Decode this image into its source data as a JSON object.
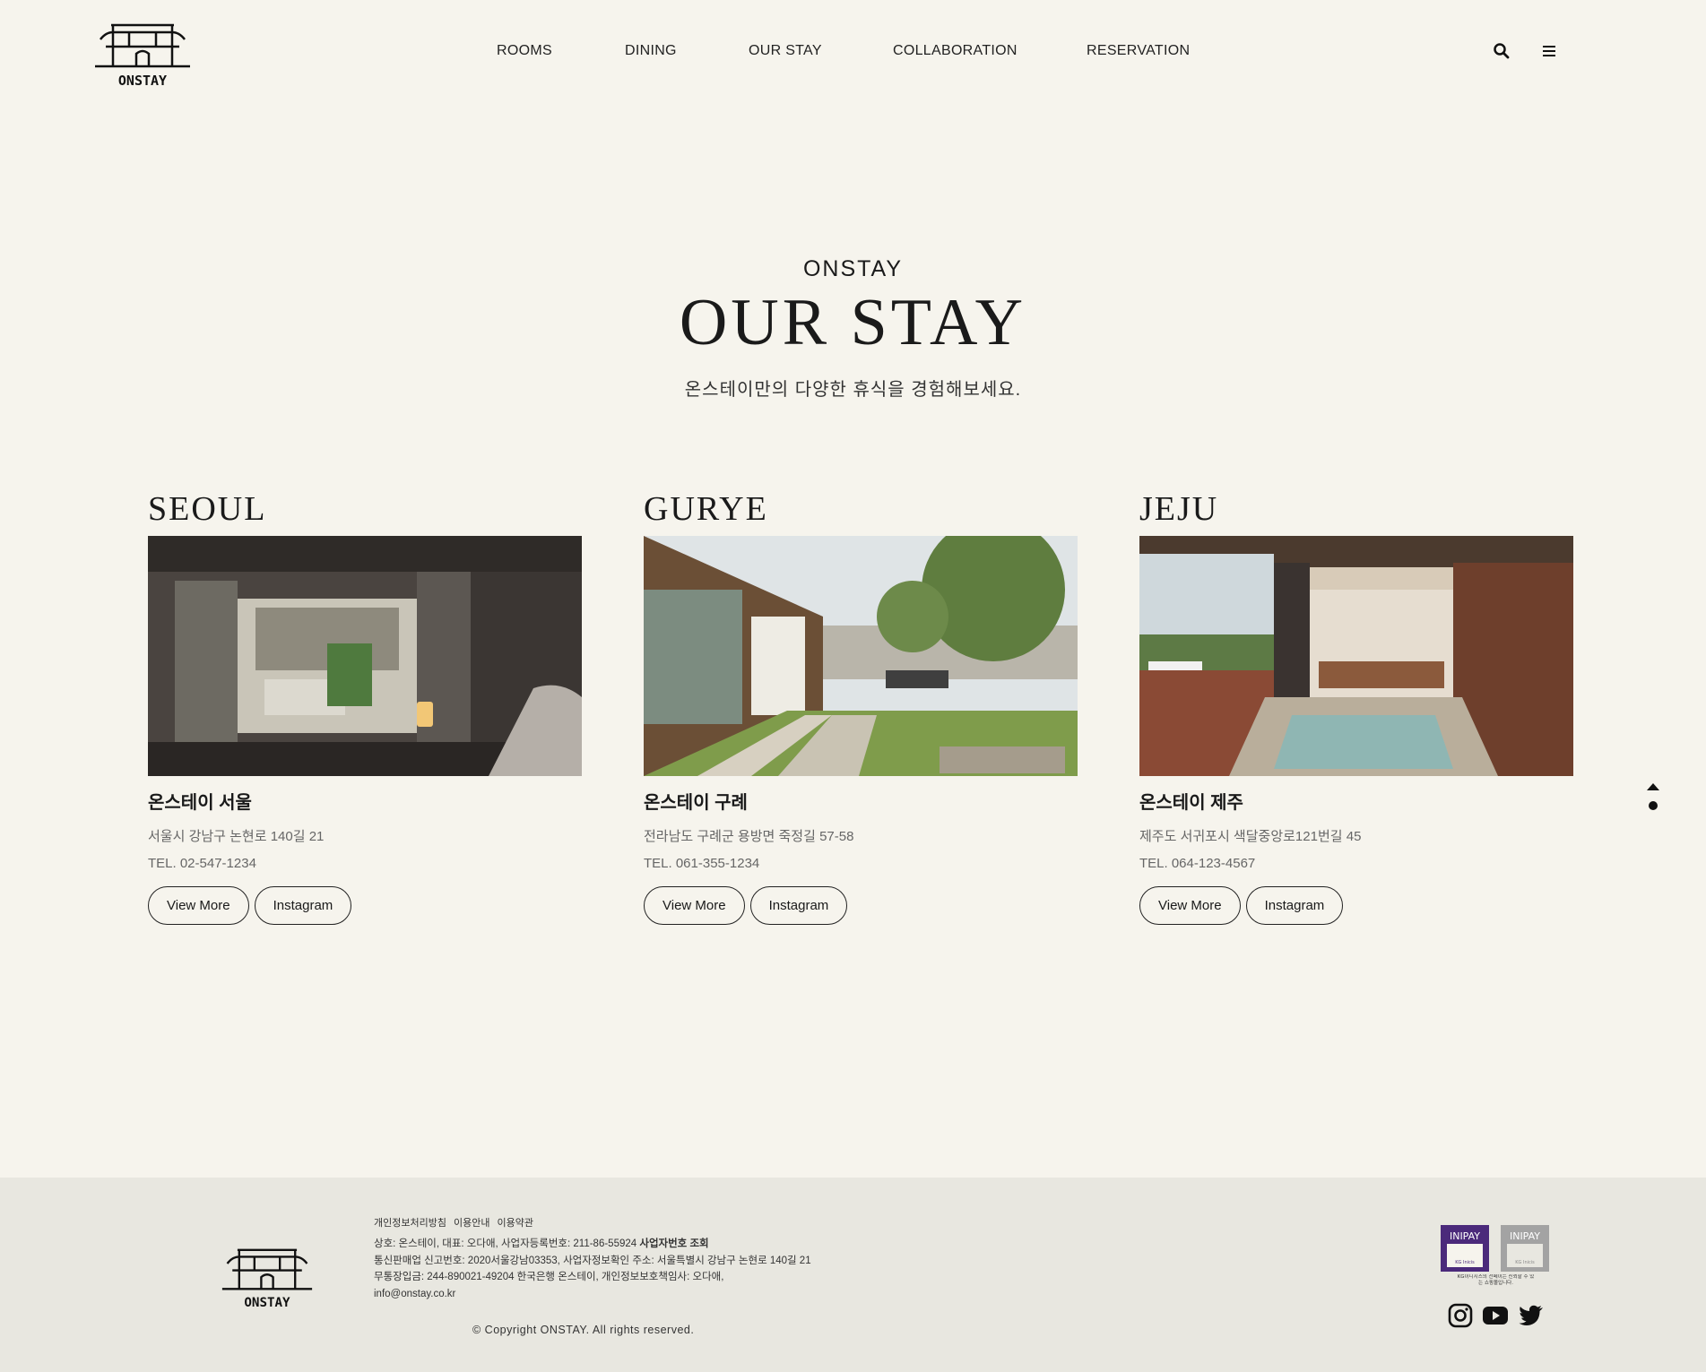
{
  "brand": {
    "logo_text": "ONSTAY"
  },
  "nav": {
    "items": [
      "ROOMS",
      "DINING",
      "OUR STAY",
      "COLLABORATION",
      "RESERVATION"
    ]
  },
  "header_icons": [
    "search-icon",
    "menu-icon"
  ],
  "hero": {
    "subtitle": "ONSTAY",
    "title": "OUR STAY",
    "description": "온스테이만의 다양한 휴식을 경험해보세요."
  },
  "stays": [
    {
      "city": "SEOUL",
      "name": "온스테이 서울",
      "address": "서울시 강남구 논현로 140길 21",
      "tel": "TEL. 02-547-1234",
      "view_more": "View More",
      "instagram": "Instagram"
    },
    {
      "city": "GURYE",
      "name": "온스테이 구례",
      "address": "전라남도 구례군 용방면 죽정길 57-58",
      "tel": "TEL. 061-355-1234",
      "view_more": "View More",
      "instagram": "Instagram"
    },
    {
      "city": "JEJU",
      "name": "온스테이 제주",
      "address": "제주도 서귀포시 색달중앙로121번길 45",
      "tel": "TEL. 064-123-4567",
      "view_more": "View More",
      "instagram": "Instagram"
    }
  ],
  "footer": {
    "links": [
      "개인정보처리방침",
      "이용안내",
      "이용약관"
    ],
    "line1": "상호: 온스테이, 대표: 오다애, 사업자등록번호: 211-86-55924",
    "line1_link": "사업자번호 조회",
    "line2": "통신판매업 신고번호: 2020서울강남03353, 사업자정보확인 주소: 서울특별시 강남구 논현로 140길 21",
    "line3": "무통장입금: 244-890021-49204 한국은행 온스테이, 개인정보보호책임사: 오다애,",
    "email": "info@onstay.co.kr",
    "copyright": "© Copyright ONSTAY. All rights reserved.",
    "badge_label": "INIPAY",
    "badge_sub": "KG Inicis",
    "badge_caption": "KG이니시스의 전페이는 신뢰할 수 있는 쇼핑몰입니다.",
    "social": [
      "instagram-icon",
      "youtube-icon",
      "twitter-icon"
    ]
  },
  "colors": {
    "background": "#f6f4ed",
    "footer": "#e8e7e0",
    "badge": "#4b2a7b"
  }
}
